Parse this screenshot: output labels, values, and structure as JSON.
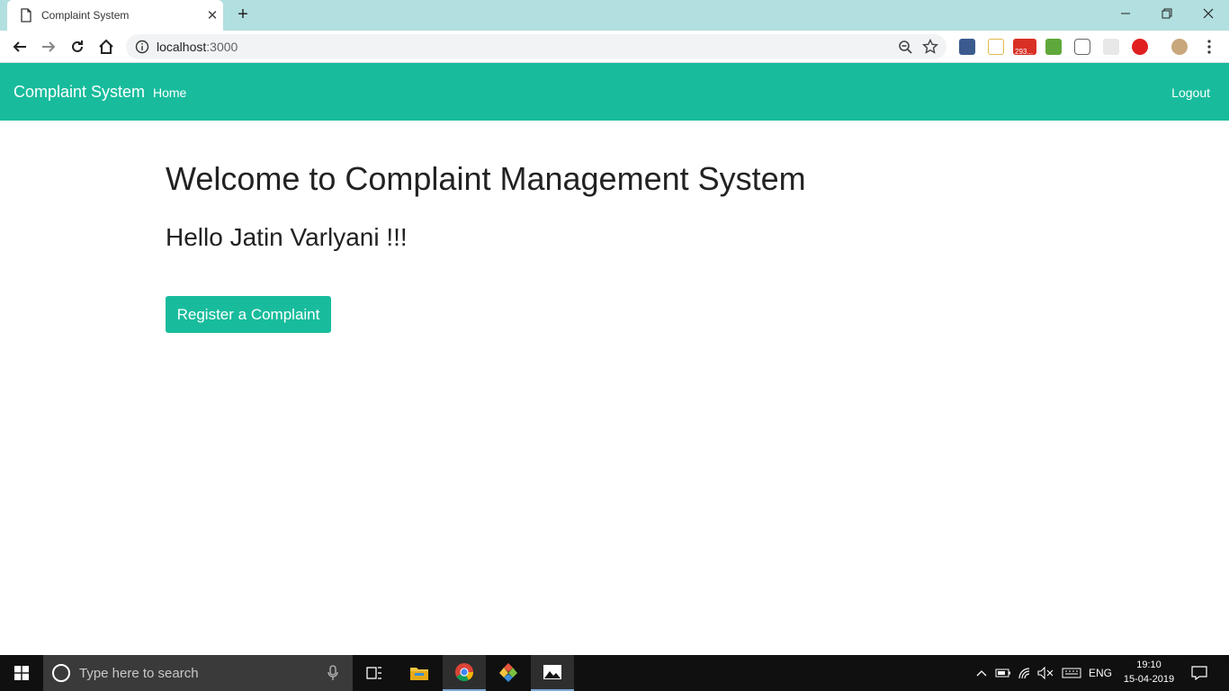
{
  "browser": {
    "tab_title": "Complaint System",
    "url_host": "localhost",
    "url_port": ":3000",
    "extension_badge": "293..."
  },
  "navbar": {
    "brand": "Complaint System",
    "home": "Home",
    "logout": "Logout"
  },
  "main": {
    "heading": "Welcome to Complaint Management System",
    "greeting": "Hello Jatin Varlyani !!!",
    "register_button": "Register a Complaint"
  },
  "taskbar": {
    "search_placeholder": "Type here to search",
    "language": "ENG",
    "time": "19:10",
    "date": "15-04-2019"
  },
  "colors": {
    "accent": "#18bc9c",
    "tab_strip": "#b2dfdf"
  }
}
